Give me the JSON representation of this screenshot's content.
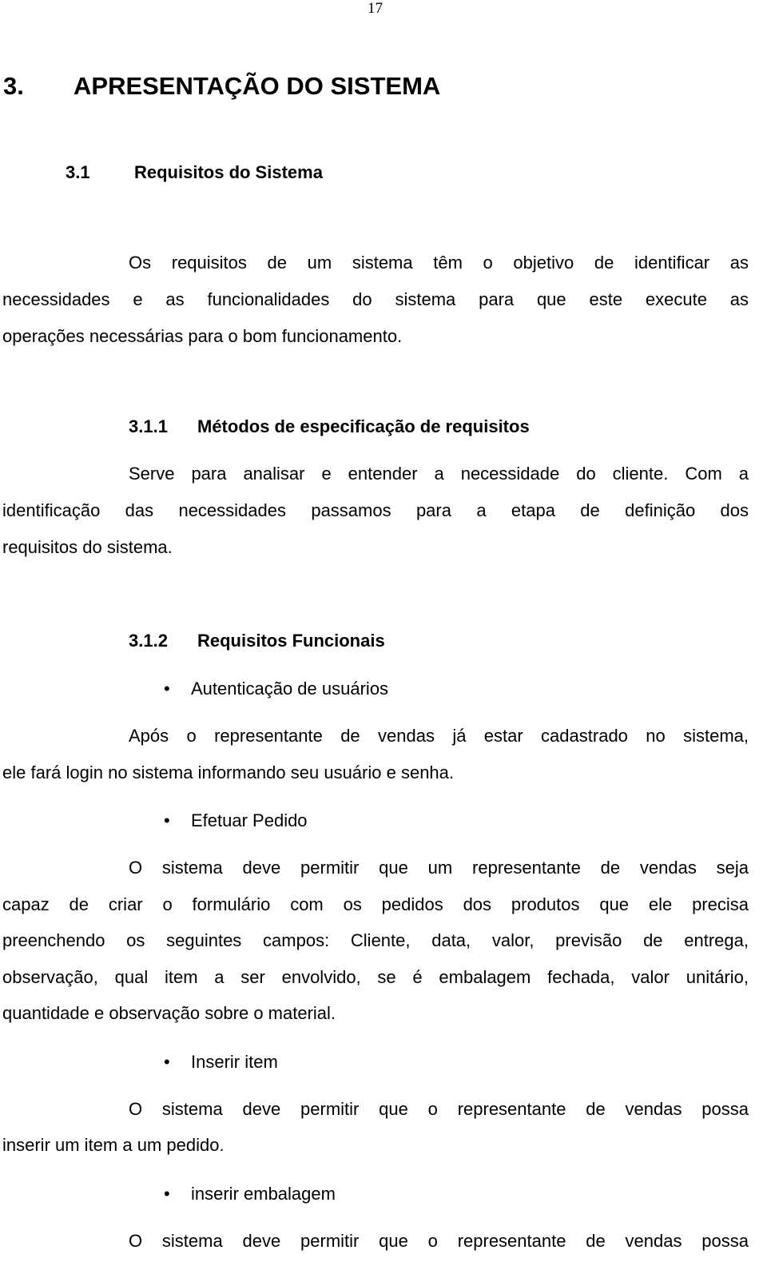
{
  "page_number": "17",
  "chapter": {
    "number": "3.",
    "title": "APRESENTAÇÃO DO SISTEMA"
  },
  "section": {
    "number": "3.1",
    "title": "Requisitos do Sistema"
  },
  "section_intro": [
    "Os requisitos de um sistema têm o objetivo de identificar as",
    "necessidades e as funcionalidades do sistema para que este execute as",
    "operações necessárias para o bom funcionamento."
  ],
  "subsection_1": {
    "number": "3.1.1",
    "title": "Métodos de especificação de requisitos",
    "paragraph": [
      "Serve para analisar e entender a necessidade do cliente. Com a",
      "identificação das necessidades passamos para a etapa de definição dos",
      "requisitos do sistema."
    ]
  },
  "subsection_2": {
    "number": "3.1.2",
    "title": "Requisitos Funcionais",
    "bullet_glyph": "•",
    "items": [
      {
        "label": "Autenticação de usuários",
        "paragraph": [
          "Após o representante de vendas já estar cadastrado no sistema,",
          "ele fará login no sistema informando seu usuário e senha."
        ]
      },
      {
        "label": "Efetuar Pedido",
        "paragraph": [
          "O sistema deve permitir que um representante de vendas seja",
          "capaz de criar o formulário com os pedidos dos produtos que ele precisa",
          "preenchendo os seguintes campos: Cliente, data, valor, previsão de entrega,",
          "observação, qual item a ser envolvido, se é embalagem fechada, valor unitário,",
          "quantidade e observação sobre o material."
        ]
      },
      {
        "label": "Inserir item",
        "paragraph": [
          "O sistema deve permitir que o representante de vendas possa",
          "inserir um item a um pedido."
        ]
      },
      {
        "label": "inserir embalagem",
        "paragraph": [
          "O sistema deve permitir que o representante de vendas possa"
        ]
      }
    ]
  }
}
